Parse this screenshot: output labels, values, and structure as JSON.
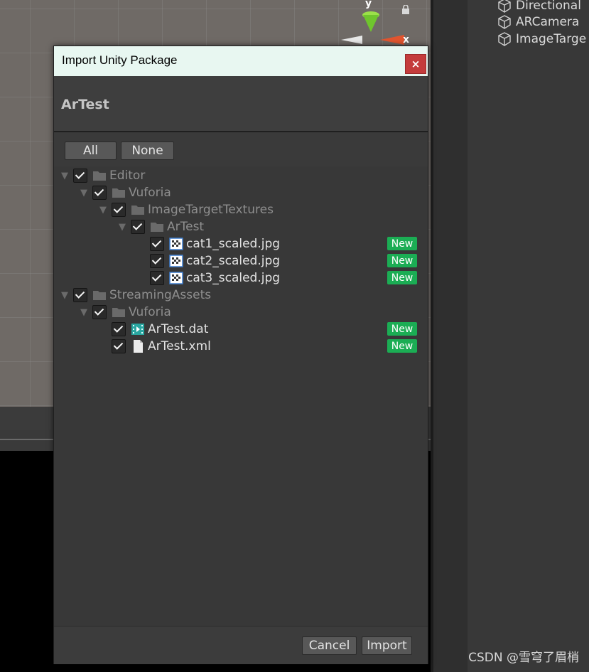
{
  "scene": {
    "gizmo_y": "y",
    "gizmo_x": "x"
  },
  "hierarchy": {
    "items": [
      {
        "label": "Directional",
        "icon": "gameobject-cube-icon"
      },
      {
        "label": "ARCamera",
        "icon": "gameobject-cube-icon"
      },
      {
        "label": "ImageTarge",
        "icon": "gameobject-cube-icon"
      }
    ]
  },
  "dialog": {
    "title": "Import Unity Package",
    "close_label": "×",
    "package_name": "ArTest",
    "all_label": "All",
    "none_label": "None",
    "new_badge": "New",
    "cancel_label": "Cancel",
    "import_label": "Import"
  },
  "tree": [
    {
      "label": "Editor",
      "kind": "folder",
      "depth": 0,
      "expanded": true,
      "checked": true
    },
    {
      "label": "Vuforia",
      "kind": "folder",
      "depth": 1,
      "expanded": true,
      "checked": true
    },
    {
      "label": "ImageTargetTextures",
      "kind": "folder",
      "depth": 2,
      "expanded": true,
      "checked": true
    },
    {
      "label": "ArTest",
      "kind": "folder",
      "depth": 3,
      "expanded": true,
      "checked": true
    },
    {
      "label": "cat1_scaled.jpg",
      "kind": "image",
      "depth": 4,
      "checked": true,
      "is_new": true
    },
    {
      "label": "cat2_scaled.jpg",
      "kind": "image",
      "depth": 4,
      "checked": true,
      "is_new": true
    },
    {
      "label": "cat3_scaled.jpg",
      "kind": "image",
      "depth": 4,
      "checked": true,
      "is_new": true
    },
    {
      "label": "StreamingAssets",
      "kind": "folder",
      "depth": 0,
      "expanded": true,
      "checked": true
    },
    {
      "label": "Vuforia",
      "kind": "folder",
      "depth": 1,
      "expanded": true,
      "checked": true
    },
    {
      "label": "ArTest.dat",
      "kind": "data",
      "depth": 2,
      "checked": true,
      "is_new": true
    },
    {
      "label": "ArTest.xml",
      "kind": "document",
      "depth": 2,
      "checked": true,
      "is_new": true
    }
  ],
  "watermark": "CSDN @雪穹了眉梢",
  "colors": {
    "new_badge": "#1bad54",
    "close_button": "#c43c3c",
    "titlebar": "#e8f7f1"
  }
}
